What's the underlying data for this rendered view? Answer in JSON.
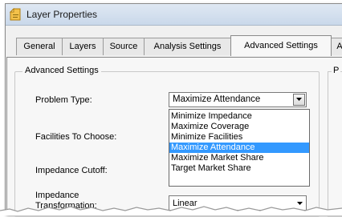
{
  "window": {
    "title": "Layer Properties",
    "icon": "layer-properties-icon"
  },
  "tabs": [
    {
      "label": "General"
    },
    {
      "label": "Layers"
    },
    {
      "label": "Source"
    },
    {
      "label": "Analysis Settings"
    },
    {
      "label": "Advanced Settings",
      "active": true
    },
    {
      "label": "A"
    }
  ],
  "advanced_group": {
    "legend": "Advanced Settings",
    "problem_type_label": "Problem Type:",
    "problem_type_value": "Maximize Attendance",
    "problem_type_options": [
      "Minimize Impedance",
      "Maximize Coverage",
      "Minimize Facilities",
      "Maximize Attendance",
      "Maximize Market Share",
      "Target Market Share"
    ],
    "problem_type_selected": "Maximize Attendance",
    "facilities_label": "Facilities To Choose:",
    "impedance_cutoff_label": "Impedance Cutoff:",
    "impedance_transformation_label_line1": "Impedance",
    "impedance_transformation_label_line2": "Transformation:",
    "impedance_transformation_value": "Linear"
  },
  "side_group": {
    "legend": "P"
  },
  "colors": {
    "selection": "#3399ff",
    "window_bg": "#f0f0f0"
  }
}
